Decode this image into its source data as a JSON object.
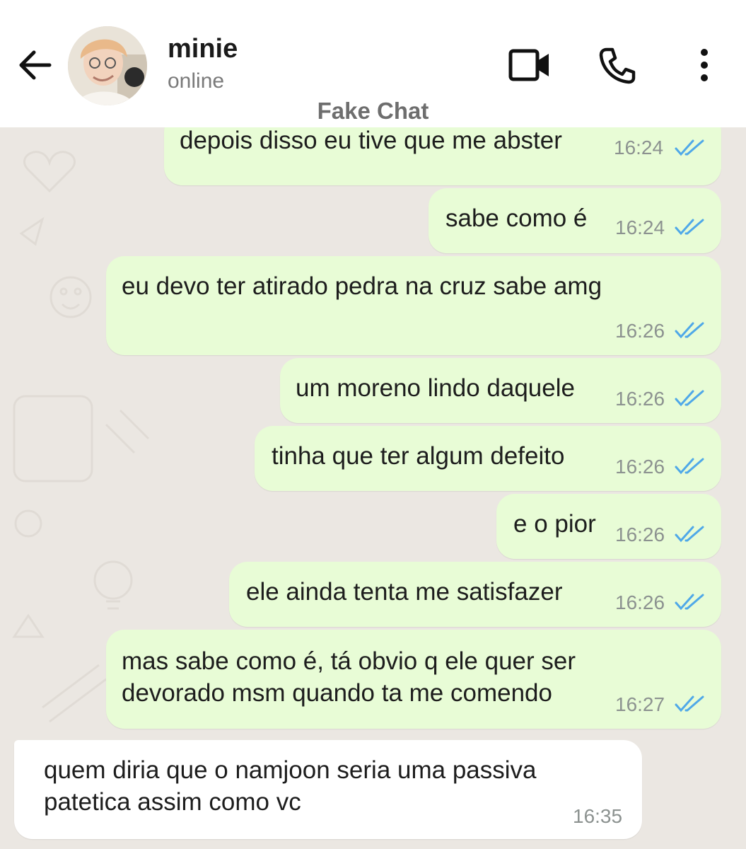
{
  "header": {
    "contact_name": "minie",
    "status": "online",
    "icons": [
      "back-arrow-icon",
      "video-call-icon",
      "voice-call-icon",
      "more-options-icon"
    ],
    "accent_color": "#ffffff"
  },
  "watermark": "Fake Chat",
  "colors": {
    "outgoing": "#e8fcd6",
    "incoming": "#ffffff",
    "read_ticks": "#4fa8e8",
    "background": "#ebe7e2"
  },
  "messages": [
    {
      "dir": "out",
      "text": "depois disso eu tive que me abster",
      "time": "16:24",
      "read": true
    },
    {
      "dir": "out",
      "text": "sabe como é",
      "time": "16:24",
      "read": true
    },
    {
      "dir": "out",
      "text": "eu devo ter atirado pedra na cruz sabe amg",
      "time": "16:26",
      "read": true
    },
    {
      "dir": "out",
      "text": "um moreno lindo daquele",
      "time": "16:26",
      "read": true
    },
    {
      "dir": "out",
      "text": "tinha que ter algum defeito",
      "time": "16:26",
      "read": true
    },
    {
      "dir": "out",
      "text": "e o pior",
      "time": "16:26",
      "read": true
    },
    {
      "dir": "out",
      "text": "ele ainda tenta me satisfazer",
      "time": "16:26",
      "read": true
    },
    {
      "dir": "out",
      "text_line1": "mas sabe como é, tá obvio q ele quer ser",
      "text_line2": "devorado msm quando ta me comendo",
      "time": "16:27",
      "read": true
    },
    {
      "dir": "in",
      "text_line1": "quem diria que o namjoon seria uma passiva",
      "text_line2": "patetica assim como vc",
      "time": "16:35"
    }
  ]
}
